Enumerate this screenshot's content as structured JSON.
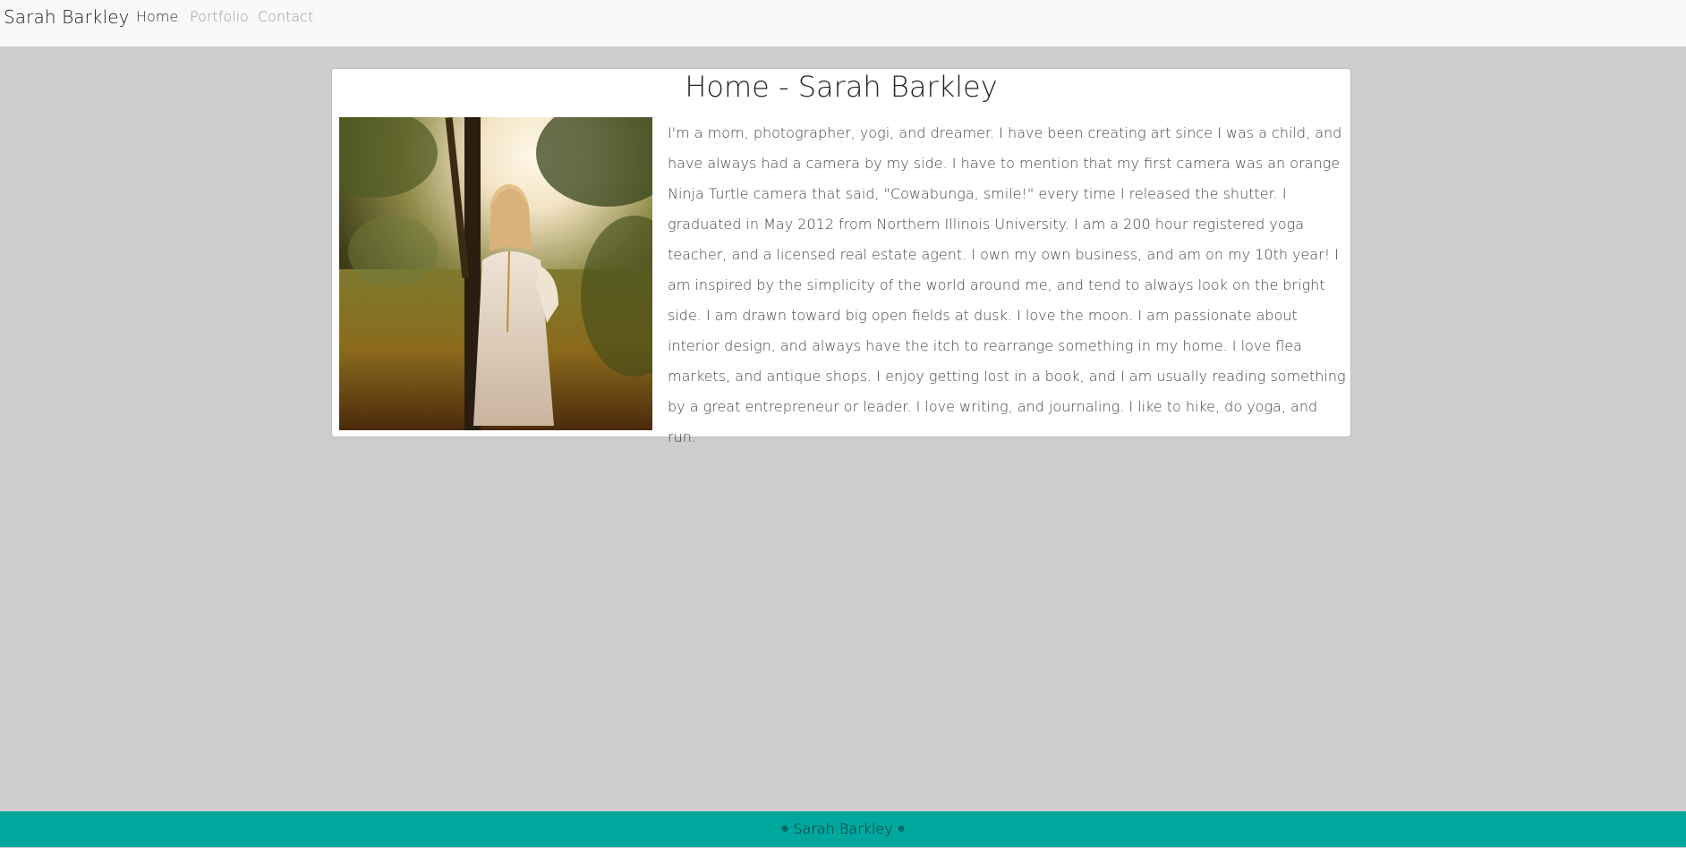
{
  "navbar": {
    "brand": "Sarah Barkley",
    "links": [
      {
        "label": "Home",
        "active": true
      },
      {
        "label": "Portfolio",
        "active": false
      },
      {
        "label": "Contact",
        "active": false
      }
    ]
  },
  "main": {
    "title": "Home - Sarah Barkley",
    "bio": "I'm a mom, photographer, yogi, and dreamer. I have been creating art since I was a child, and have always had a camera by my side. I have to mention that my first camera was an orange Ninja Turtle camera that said, \"Cowabunga, smile!\" every time I released the shutter. I graduated in May 2012 from Northern Illinois University. I am a 200 hour registered yoga teacher, and a licensed real estate agent. I own my own business, and am on my 10th year! I am inspired by the simplicity of the world around me, and tend to always look on the bright side. I am drawn toward big open fields at dusk. I love the moon. I am passionate about interior design, and always have the itch to rearrange something in my home. I love flea markets, and antique shops. I enjoy getting lost in a book, and I am usually reading something by a great entrepreneur or leader. I love writing, and journaling. I like to hike, do yoga, and run."
  },
  "footer": {
    "text": "Sarah Barkley",
    "icon_left": "⊕",
    "icon_right": "⊕"
  },
  "colors": {
    "page_bg": "#cdcdcd",
    "navbar_bg": "#f8f9fa",
    "footer_bg": "#00a79d"
  }
}
